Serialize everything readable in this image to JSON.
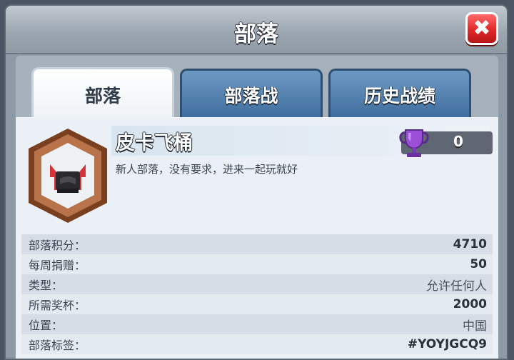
{
  "dialog": {
    "title": "部落",
    "close_icon": "close-icon"
  },
  "tabs": [
    {
      "label": "部落",
      "active": true
    },
    {
      "label": "部落战",
      "active": false
    },
    {
      "label": "历史战绩",
      "active": false
    }
  ],
  "clan": {
    "name": "皮卡飞桶",
    "description": "新人部落，没有要求，进来一起玩就好",
    "trophies": "0",
    "badge_icon": "clan-badge-icon",
    "trophy_icon": "trophy-icon"
  },
  "info": [
    {
      "label": "部落积分：",
      "value": "4710"
    },
    {
      "label": "每周捐赠：",
      "value": "50"
    },
    {
      "label": "类型：",
      "value": "允许任何人"
    },
    {
      "label": "所需奖杯：",
      "value": "2000"
    },
    {
      "label": "位置：",
      "value": "中国"
    },
    {
      "label": "部落标签：",
      "value": "#YOYJGCQ9"
    }
  ],
  "colors": {
    "tab_active": "#ffffff",
    "tab_inactive": "#4a7aab",
    "close_button": "#e02828",
    "trophy": "#9b4fd6"
  }
}
